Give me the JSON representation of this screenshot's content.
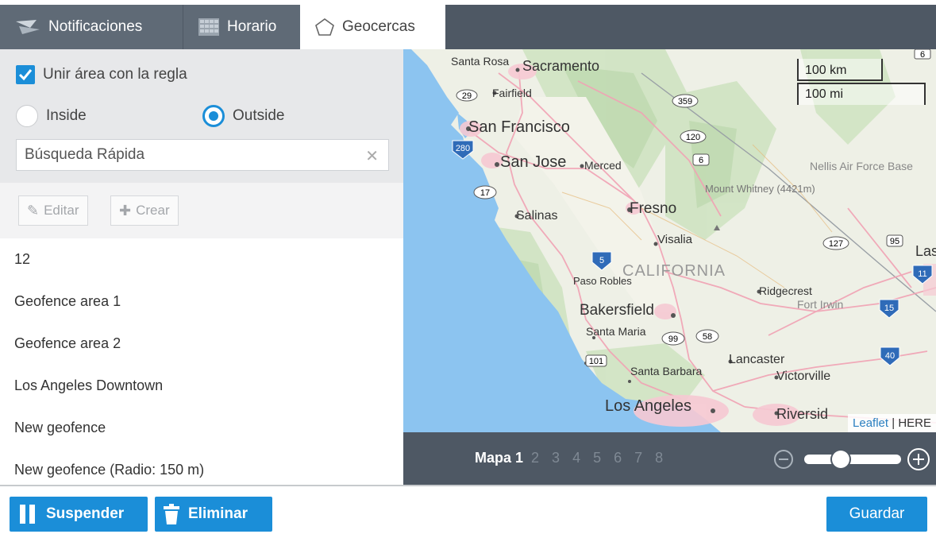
{
  "tabs": {
    "notifications": "Notificaciones",
    "schedule": "Horario",
    "geofences": "Geocercas"
  },
  "filters": {
    "join_area_label": "Unir área con la regla",
    "join_area_checked": true,
    "inside_label": "Inside",
    "outside_label": "Outside",
    "selected_mode": "Outside",
    "search_placeholder": "Búsqueda Rápida",
    "search_value": ""
  },
  "toolbar": {
    "edit_label": "Editar",
    "create_label": "Crear"
  },
  "geofence_list": [
    "12",
    "Geofence area 1",
    "Geofence area 2",
    "Los Angeles Downtown",
    "New geofence",
    "New geofence (Radio: 150 m)"
  ],
  "map": {
    "scale_km": "100 km",
    "scale_mi": "100 mi",
    "attribution_link": "Leaflet",
    "attribution_sep": "|",
    "attribution_provider": "HERE",
    "labels": {
      "santa_rosa": "Santa Rosa",
      "sacramento": "Sacramento",
      "fairfield": "Fairfield",
      "san_francisco": "San Francisco",
      "san_jose": "San Jose",
      "merced": "Merced",
      "nellis": "Nellis Air Force Base",
      "mount_whitney": "Mount Whitney (4421m)",
      "salinas": "Salinas",
      "fresno": "Fresno",
      "visalia": "Visalia",
      "california": "CALIFORNIA",
      "las": "Las",
      "paso_robles": "Paso Robles",
      "ridgecrest": "Ridgecrest",
      "fort_irwin": "Fort Irwin",
      "bakersfield": "Bakersfield",
      "santa_maria": "Santa Maria",
      "lancaster": "Lancaster",
      "victorville": "Victorville",
      "santa_barbara": "Santa Barbara",
      "los_angeles": "Los Angeles",
      "riverside": "Riversid"
    },
    "route_shields": [
      "6",
      "29",
      "359",
      "280",
      "120",
      "6",
      "17",
      "127",
      "95",
      "5",
      "11",
      "15",
      "99",
      "58",
      "101",
      "40"
    ]
  },
  "map_pages": {
    "current_label": "Mapa 1",
    "others": [
      "2",
      "3",
      "4",
      "5",
      "6",
      "7",
      "8"
    ],
    "zoom_level": 0.35
  },
  "actions": {
    "suspend": "Suspender",
    "delete": "Eliminar",
    "save": "Guardar"
  },
  "colors": {
    "accent": "#1b8ed8",
    "tabbar": "#4e5864",
    "water": "#8cc4f0"
  }
}
